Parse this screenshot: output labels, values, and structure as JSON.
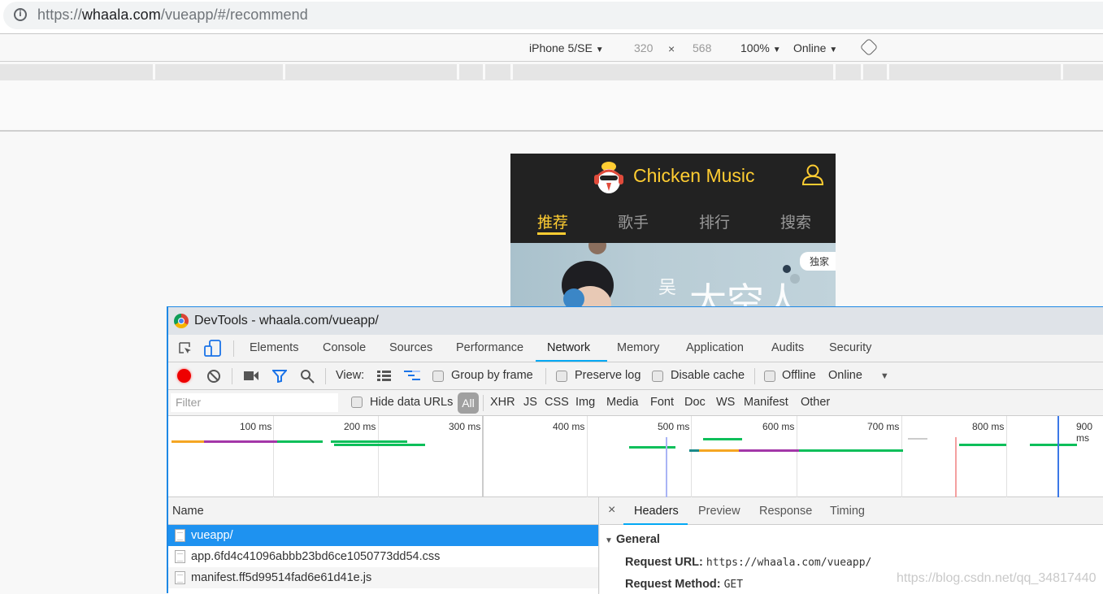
{
  "browser": {
    "url_prefix": "https://",
    "url_host": "whaala.com",
    "url_path": "/vueapp/#/recommend"
  },
  "device_toolbar": {
    "device": "iPhone 5/SE",
    "width": "320",
    "times": "×",
    "height": "568",
    "zoom": "100%",
    "throttle": "Online",
    "dropdown_glyph": "▼"
  },
  "app": {
    "brand": "Chicken Music",
    "tabs": [
      {
        "label": "推荐",
        "active": true
      },
      {
        "label": "歌手",
        "active": false
      },
      {
        "label": "排行",
        "active": false
      },
      {
        "label": "搜索",
        "active": false
      }
    ],
    "banner_badge": "独家",
    "accent_color": "#ffcd32"
  },
  "devtools": {
    "title": "DevTools - whaala.com/vueapp/",
    "tabs": [
      "Elements",
      "Console",
      "Sources",
      "Performance",
      "Network",
      "Memory",
      "Application",
      "Audits",
      "Security"
    ],
    "active_tab": "Network",
    "toolbar": {
      "view_label": "View:",
      "group_by_frame": "Group by frame",
      "preserve_log": "Preserve log",
      "disable_cache": "Disable cache",
      "offline": "Offline",
      "throttle": "Online"
    },
    "filter": {
      "placeholder": "Filter",
      "hide_data_urls": "Hide data URLs",
      "types": [
        "All",
        "XHR",
        "JS",
        "CSS",
        "Img",
        "Media",
        "Font",
        "Doc",
        "WS",
        "Manifest",
        "Other"
      ],
      "active_type": "All"
    },
    "timeline": {
      "ticks": [
        "100 ms",
        "200 ms",
        "300 ms",
        "400 ms",
        "500 ms",
        "600 ms",
        "700 ms",
        "800 ms",
        "900 ms"
      ]
    },
    "requests": {
      "column": "Name",
      "items": [
        {
          "name": "vueapp/",
          "selected": true
        },
        {
          "name": "app.6fd4c41096abbb23bd6ce1050773dd54.css",
          "selected": false
        },
        {
          "name": "manifest.ff5d99514fad6e61d41e.js",
          "selected": false
        }
      ]
    },
    "detail": {
      "close": "×",
      "tabs": [
        "Headers",
        "Preview",
        "Response",
        "Timing"
      ],
      "active_tab": "Headers",
      "section": "General",
      "section_arrow": "▼",
      "fields": [
        {
          "key": "Request URL:",
          "value": "https://whaala.com/vueapp/"
        },
        {
          "key": "Request Method:",
          "value": "GET"
        }
      ]
    }
  },
  "watermark": "https://blog.csdn.net/qq_34817440"
}
